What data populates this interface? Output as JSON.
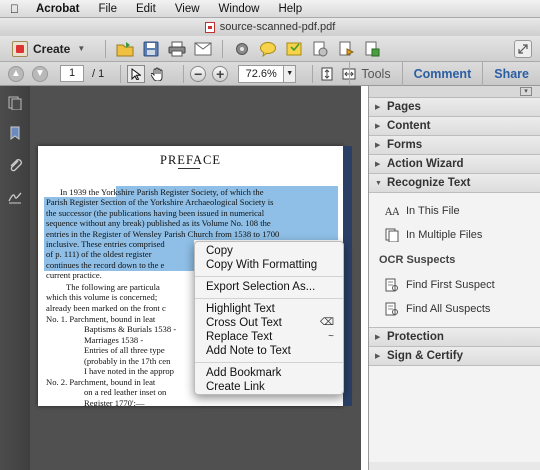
{
  "menubar": {
    "app": "Acrobat",
    "items": [
      "File",
      "Edit",
      "View",
      "Window",
      "Help"
    ]
  },
  "window": {
    "title": "source-scanned-pdf.pdf"
  },
  "toolbar": {
    "create_label": "Create"
  },
  "nav": {
    "page_current": "1",
    "page_total": "/ 1",
    "zoom": "72.6%"
  },
  "tabs": [
    "Tools",
    "Comment",
    "Share"
  ],
  "document": {
    "title": "PREFACE",
    "lines": [
      "In 1939 the Yorkshire Parish Register Society, of which the",
      "Parish Register Section of the Yorkshire Archaeological Society is",
      "the successor (the publications having been issued in numerical",
      "sequence without any break) published as its Volume No. 108 the",
      "entries in the Register of Wensley Parish Church from 1538 to 1700",
      "inclusive. These entries comprised",
      "of p. 111) of the oldest register",
      "continues the record down to the e",
      "current practice.",
      "The following are particula",
      "which this volume is concerned;",
      "already been marked on the front c",
      "No. 1.  Parchment, bound in leat",
      "Baptisms & Burials 1538 -",
      "Marriages          1538 -",
      "Entries of all three type",
      "(probably in the 17th cen",
      "I have noted in the approp",
      "No. 2.  Parchment, bound in leat",
      "on a red leather inset on",
      "Register 1770':—"
    ]
  },
  "context_menu": {
    "items": [
      "Copy",
      "Copy With Formatting",
      "Export Selection As...",
      "Highlight Text",
      "Cross Out Text",
      "Replace Text",
      "Add Note to Text",
      "Add Bookmark",
      "Create Link"
    ],
    "shortcuts": {
      "cross_out": "⌫",
      "replace": "~"
    }
  },
  "tools_panel": {
    "sections": [
      "Pages",
      "Content",
      "Forms",
      "Action Wizard",
      "Recognize Text",
      "Protection",
      "Sign & Certify"
    ],
    "recognize_items": [
      "In This File",
      "In Multiple Files"
    ],
    "ocr_heading": "OCR Suspects",
    "ocr_items": [
      "Find First Suspect",
      "Find All Suspects"
    ]
  }
}
